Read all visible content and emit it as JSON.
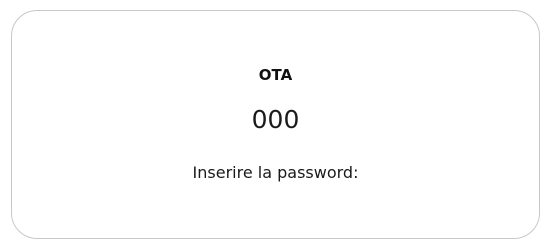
{
  "dialog": {
    "title": "OTA",
    "value": "000",
    "prompt": "Inserire la password:"
  }
}
